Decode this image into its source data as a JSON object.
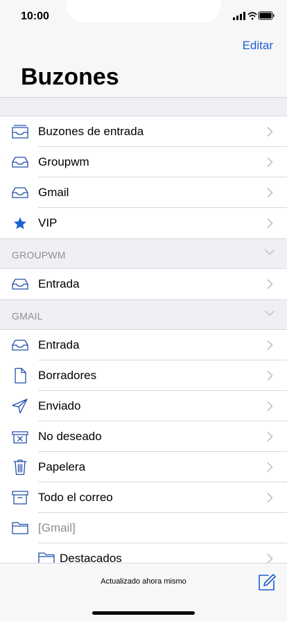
{
  "status": {
    "time": "10:00"
  },
  "header": {
    "edit_label": "Editar",
    "title": "Buzones"
  },
  "colors": {
    "accent": "#1a5fd0",
    "icon_blue": "#1f4fa8",
    "separator": "#d8d8dc",
    "section_bg": "#efeff4"
  },
  "main_mailboxes": [
    {
      "label": "Buzones de entrada",
      "icon": "inbox-tray-icon"
    },
    {
      "label": "Groupwm",
      "icon": "inbox-icon"
    },
    {
      "label": "Gmail",
      "icon": "inbox-icon"
    },
    {
      "label": "VIP",
      "icon": "star-icon"
    }
  ],
  "groupwm_section": {
    "title": "GROUPWM",
    "items": [
      {
        "label": "Entrada",
        "icon": "inbox-icon"
      }
    ]
  },
  "gmail_section": {
    "title": "GMAIL",
    "items": [
      {
        "label": "Entrada",
        "icon": "inbox-icon"
      },
      {
        "label": "Borradores",
        "icon": "document-icon"
      },
      {
        "label": "Enviado",
        "icon": "paper-plane-icon"
      },
      {
        "label": "No deseado",
        "icon": "junk-icon"
      },
      {
        "label": "Papelera",
        "icon": "trash-icon"
      },
      {
        "label": "Todo el correo",
        "icon": "archive-box-icon"
      },
      {
        "label": "[Gmail]",
        "icon": "folder-icon"
      },
      {
        "label": "Destacados",
        "icon": "folder-icon"
      }
    ]
  },
  "footer": {
    "updated_text": "Actualizado ahora mismo"
  }
}
